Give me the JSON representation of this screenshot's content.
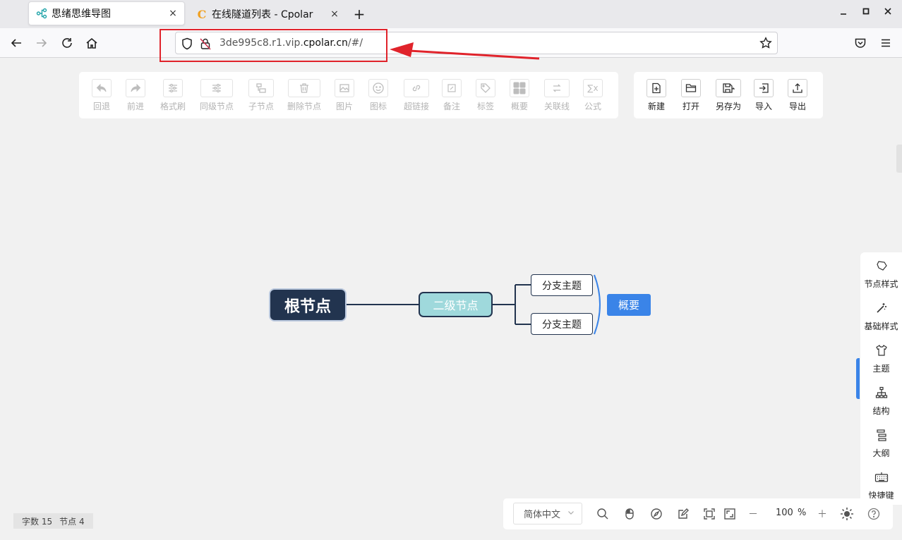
{
  "browser": {
    "tabs": [
      {
        "title": "思绪思维导图",
        "close": "×"
      },
      {
        "title": "在线隧道列表 - Cpolar",
        "favicon_letter": "C",
        "close": "×"
      }
    ],
    "new_tab": "+",
    "url_host_prefix": "3de995c8.r1.vip.",
    "url_host_domain": "cpolar.cn",
    "url_path": "/#/"
  },
  "edit_toolbar": {
    "items": [
      {
        "label": "回退",
        "icon": "undo-icon"
      },
      {
        "label": "前进",
        "icon": "redo-icon"
      },
      {
        "label": "格式刷",
        "icon": "format-brush-icon"
      },
      {
        "label": "同级节点",
        "icon": "sibling-node-icon"
      },
      {
        "label": "子节点",
        "icon": "child-node-icon"
      },
      {
        "label": "删除节点",
        "icon": "delete-icon"
      },
      {
        "label": "图片",
        "icon": "image-icon"
      },
      {
        "label": "图标",
        "icon": "emoji-icon"
      },
      {
        "label": "超链接",
        "icon": "link-icon"
      },
      {
        "label": "备注",
        "icon": "note-icon"
      },
      {
        "label": "标签",
        "icon": "tag-icon"
      },
      {
        "label": "概要",
        "icon": "summary-icon"
      },
      {
        "label": "关联线",
        "icon": "relation-line-icon"
      },
      {
        "label": "公式",
        "icon": "formula-icon"
      }
    ]
  },
  "file_toolbar": {
    "items": [
      {
        "label": "新建",
        "icon": "new-file-icon"
      },
      {
        "label": "打开",
        "icon": "open-folder-icon"
      },
      {
        "label": "另存为",
        "icon": "save-as-icon"
      },
      {
        "label": "导入",
        "icon": "import-icon"
      },
      {
        "label": "导出",
        "icon": "export-icon"
      }
    ]
  },
  "mindmap": {
    "root": "根节点",
    "second": "二级节点",
    "branches": [
      "分支主题",
      "分支主题"
    ],
    "summary": "概要",
    "colors": {
      "root_bg": "#22344f",
      "second_bg": "#9fd9dc",
      "summary_bg": "#3a84e8",
      "summary_bracket": "#3a84e8"
    }
  },
  "side_panel": {
    "items": [
      {
        "label": "节点样式",
        "icon": "node-style-icon"
      },
      {
        "label": "基础样式",
        "icon": "magic-wand-icon"
      },
      {
        "label": "主题",
        "icon": "shirt-icon"
      },
      {
        "label": "结构",
        "icon": "structure-icon"
      },
      {
        "label": "大纲",
        "icon": "outline-icon"
      },
      {
        "label": "快捷键",
        "icon": "keyboard-icon"
      }
    ]
  },
  "bottom_bar": {
    "language": "简体中文",
    "zoom_value": "100",
    "zoom_unit": "%",
    "zoom_out": "－",
    "zoom_in": "＋"
  },
  "stats": {
    "word_label": "字数",
    "word_count": "15",
    "node_label": "节点",
    "node_count": "4"
  }
}
